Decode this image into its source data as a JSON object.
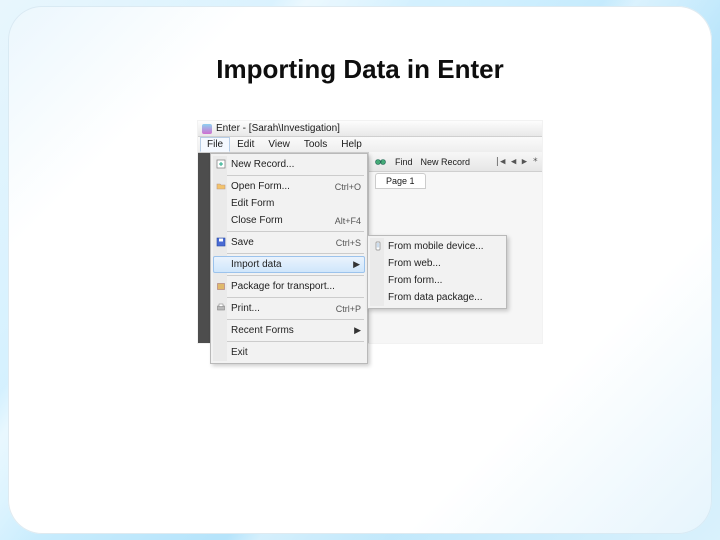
{
  "slide": {
    "title": "Importing Data in Enter"
  },
  "app": {
    "window_title": "Enter - [Sarah\\Investigation]",
    "menubar": [
      "File",
      "Edit",
      "View",
      "Tools",
      "Help"
    ],
    "toolbar": {
      "find_label": "Find",
      "new_record_label": "New Record",
      "nav_glyphs": "|◀  ◀  ▶  *"
    },
    "page_tab": "Page 1",
    "file_menu": {
      "new_record": "New Record...",
      "open_form": "Open Form...",
      "open_form_shortcut": "Ctrl+O",
      "edit_form": "Edit Form",
      "close_form": "Close Form",
      "close_form_shortcut": "Alt+F4",
      "save": "Save",
      "save_shortcut": "Ctrl+S",
      "import_data": "Import data",
      "package": "Package for transport...",
      "print": "Print...",
      "print_shortcut": "Ctrl+P",
      "recent_forms": "Recent Forms",
      "exit": "Exit"
    },
    "import_submenu": {
      "from_mobile": "From mobile device...",
      "from_web": "From web...",
      "from_form": "From form...",
      "from_package": "From data package..."
    }
  }
}
